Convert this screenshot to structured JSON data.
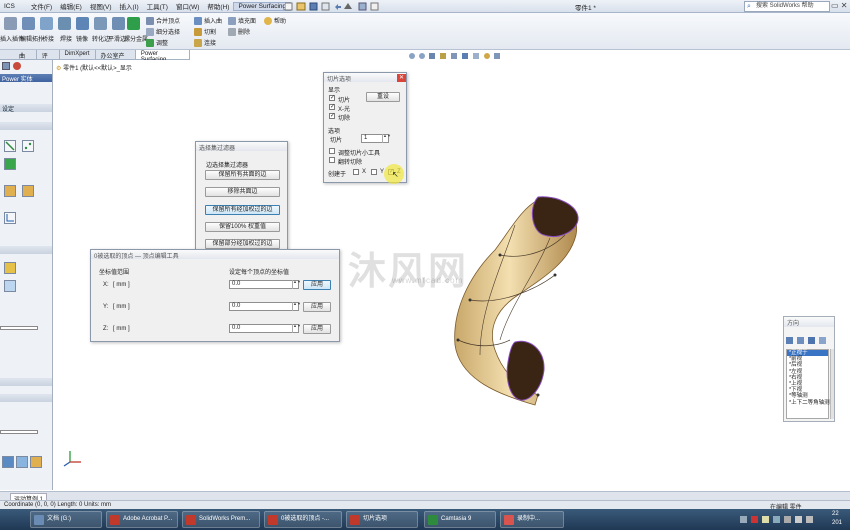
{
  "menubar": {
    "app_abbrev": "ICS",
    "items": [
      "文件(F)",
      "编辑(E)",
      "视图(V)",
      "插入(I)",
      "工具(T)",
      "窗口(W)",
      "帮助(H)",
      "Power Surfacing"
    ],
    "document_title": "零件1 *",
    "search_placeholder": "搜索 SolidWorks 帮助"
  },
  "ribbon": {
    "left_buttons": [
      "插入插件",
      "编辑拓扑",
      "桥接",
      "焊接",
      "镜像",
      "转化边",
      "平滑边",
      "螺分金属"
    ],
    "middle_items": [
      "合并顶点",
      "细分选择",
      "调整"
    ],
    "right_items": [
      "插入曲",
      "切割",
      "连接",
      "填充面",
      "删除"
    ],
    "help": "帮助"
  },
  "tabs": [
    "曲面",
    "评估",
    "DimXpert",
    "办公室产品",
    "Power Surfacing"
  ],
  "feature_tree_path": "零件1  (默认<<默认>_显示",
  "left_panel": {
    "title": "Power 实体",
    "section1": "设定"
  },
  "slice_dialog": {
    "title": "切片选项",
    "display_label": "显示",
    "slice_check": "切片",
    "xray_check": "X-光",
    "restore_check": "切除",
    "reset_button": "重设",
    "options_label": "选项",
    "slice_count_label": "切片",
    "slice_count_value": "1",
    "adjust_tool": "调整切片小工具",
    "flip_cut": "翻转切除",
    "create_at": "创建于",
    "axis_x": "X",
    "axis_y": "Y",
    "axis_z": "Z"
  },
  "filter_dialog": {
    "title": "选择集过滤器",
    "subtitle": "边选择集过滤器",
    "buttons": [
      "保留所有共面的边",
      "移除共面边",
      "保留所有经加权过的边",
      "保留100% 权重值",
      "保留部分经加权过的边"
    ]
  },
  "vertex_dialog": {
    "title": "0被选取的顶点 — 顶点编辑工具",
    "col_left": "坐标值范围",
    "col_right": "设定每个顶点的坐标值",
    "rows": [
      {
        "axis": "X:",
        "range": "[  mm  ]",
        "value": "0.0",
        "apply": "应用"
      },
      {
        "axis": "Y:",
        "range": "[  mm  ]",
        "value": "0.0",
        "apply": "应用"
      },
      {
        "axis": "Z:",
        "range": "[  mm  ]",
        "value": "0.0",
        "apply": "应用"
      }
    ]
  },
  "view_panel": {
    "title": "方向",
    "items": [
      "*正视于",
      "*前视",
      "*后视",
      "*左视",
      "*右视",
      "*上视",
      "*下视",
      "*等轴测",
      "*上下二等角轴测"
    ]
  },
  "watermark": {
    "text": "沐风网",
    "url": "www.mfcad.com"
  },
  "status": {
    "left": "Coordinate (0, 0, 0)   Length: 0   Units: mm",
    "right": "在编辑 零件",
    "bottom_tab": "运动算例 1",
    "clock_top": "22",
    "clock_bottom": "201"
  },
  "taskbar": {
    "items": [
      "文档 (G:)",
      "Adobe Acrobat P...",
      "SolidWorks Prem...",
      "0被选取的顶点 -...",
      "切片选项",
      "Camtasia 9",
      "录制中..."
    ],
    "colors": [
      "#6a8bb3",
      "#c0392b",
      "#c0392b",
      "#c0392b",
      "#c0392b",
      "#2e8b3e",
      "#d9534f"
    ]
  }
}
